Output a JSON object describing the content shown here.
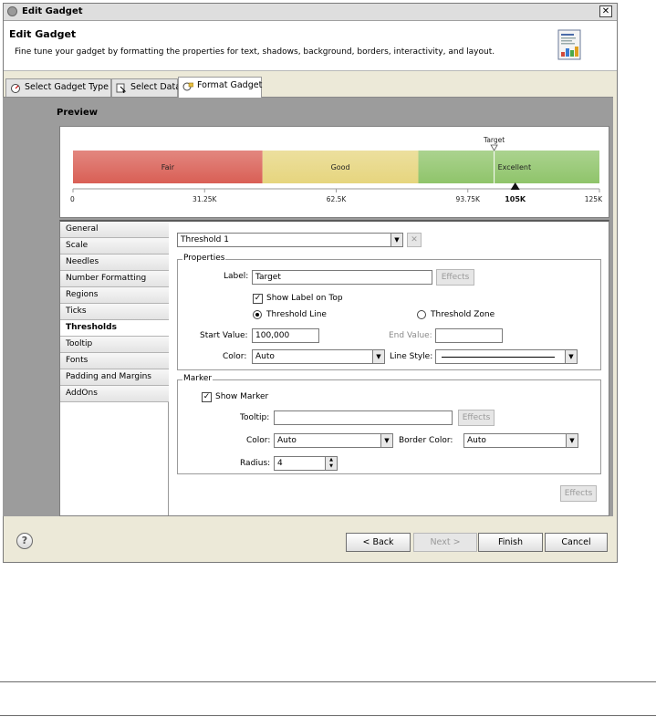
{
  "window": {
    "title": "Edit Gadget",
    "close_label": "✕"
  },
  "header": {
    "title": "Edit Gadget",
    "description": "Fine tune your gadget by formatting the properties for text, shadows, background, borders, interactivity, and layout."
  },
  "tabs": [
    {
      "label": "Select Gadget Type",
      "icon": "gadget-type-icon"
    },
    {
      "label": "Select Data",
      "icon": "select-data-icon"
    },
    {
      "label": "Format Gadget",
      "icon": "format-gadget-icon",
      "active": true
    }
  ],
  "preview": {
    "label": "Preview",
    "target_label": "Target",
    "needle_value_label": "105K",
    "regions": [
      {
        "name": "Fair",
        "from": 0,
        "to": 45000,
        "color": "#d95f55"
      },
      {
        "name": "Good",
        "from": 45000,
        "to": 82000,
        "color": "#e6d57e"
      },
      {
        "name": "Excellent",
        "from": 82000,
        "to": 125000,
        "color": "#8fc46a"
      }
    ],
    "scale_min": 0,
    "scale_max": 125000,
    "ticks": [
      "0",
      "31.25K",
      "62.5K",
      "93.75K",
      "125K"
    ],
    "target_value": 100000,
    "needle_value": 105000
  },
  "nav": {
    "items": [
      "General",
      "Scale",
      "Needles",
      "Number Formatting",
      "Regions",
      "Ticks",
      "Thresholds",
      "Tooltip",
      "Fonts",
      "Padding and Margins",
      "AddOns"
    ],
    "active": "Thresholds"
  },
  "thresholds": {
    "selector_value": "Threshold 1",
    "properties_title": "Properties",
    "label_caption": "Label:",
    "label_value": "Target",
    "effects_label": "Effects",
    "show_label_on_top": "Show Label on Top",
    "threshold_line": "Threshold Line",
    "threshold_zone": "Threshold Zone",
    "start_value_caption": "Start Value:",
    "start_value": "100,000",
    "end_value_caption": "End Value:",
    "end_value": "",
    "color_caption": "Color:",
    "color_value": "Auto",
    "line_style_caption": "Line Style:",
    "marker_title": "Marker",
    "show_marker": "Show Marker",
    "tooltip_caption": "Tooltip:",
    "tooltip_value": "",
    "marker_effects_label": "Effects",
    "marker_color_caption": "Color:",
    "marker_color_value": "Auto",
    "border_color_caption": "Border Color:",
    "border_color_value": "Auto",
    "radius_caption": "Radius:",
    "radius_value": "4",
    "bottom_effects_label": "Effects"
  },
  "footer": {
    "help_label": "?",
    "back_label": "< Back",
    "next_label": "Next >",
    "finish_label": "Finish",
    "cancel_label": "Cancel"
  }
}
